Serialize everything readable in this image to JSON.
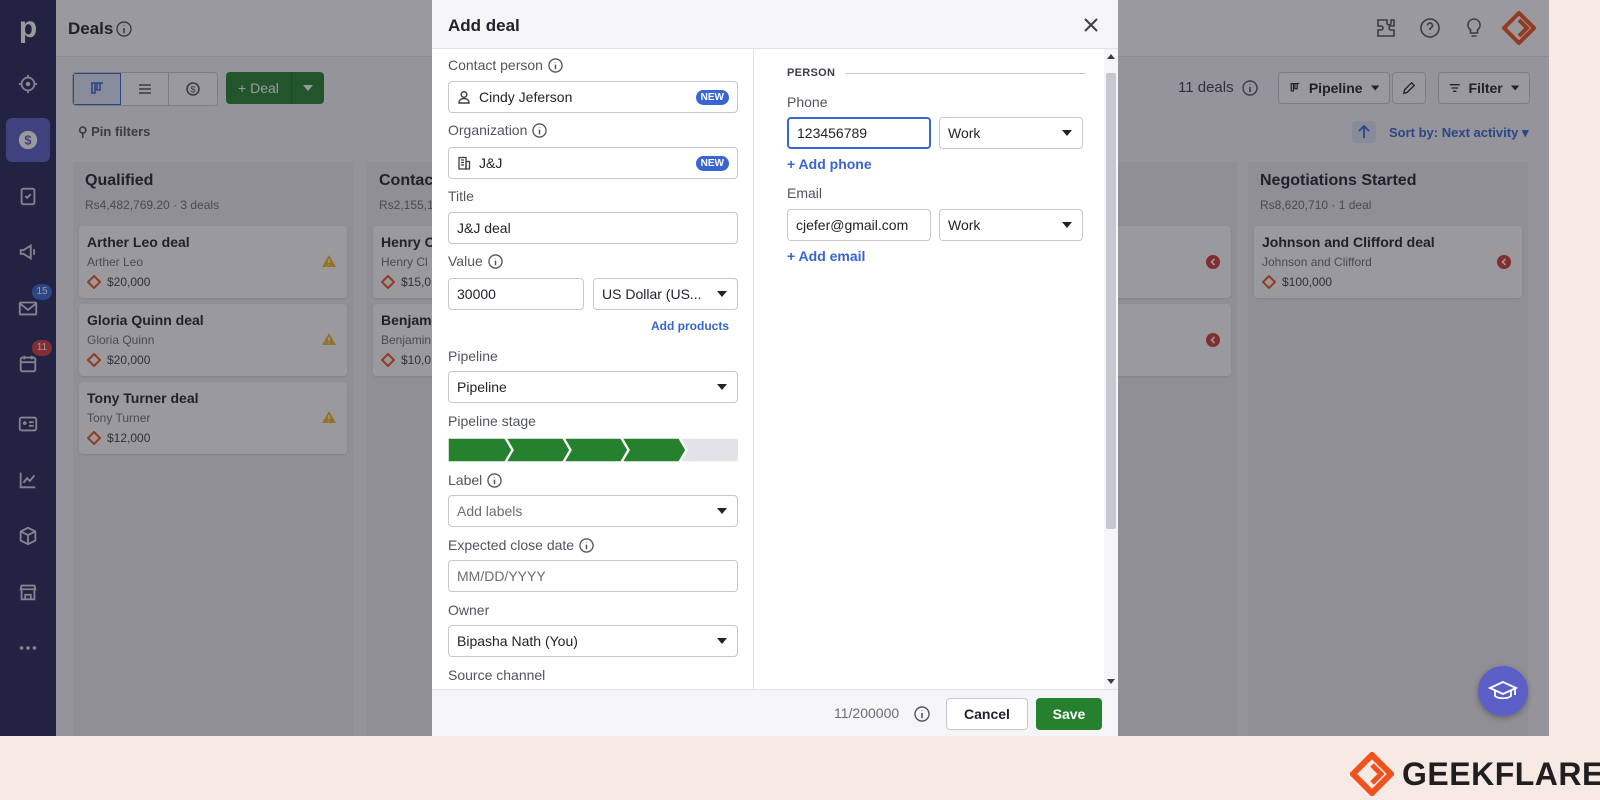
{
  "app": {
    "page_title": "Deals",
    "sidebar": {
      "mail_badge": "15",
      "calendar_badge": "11"
    },
    "toolbar": {
      "deal_button": "Deal",
      "pin_filters": "Pin filters",
      "deals_count": "11 deals",
      "pipeline_button": "Pipeline",
      "filter_button": "Filter",
      "sort_by": "Sort by: Next activity"
    },
    "columns": [
      {
        "title": "Qualified",
        "meta": "Rs4,482,769.20 · 3 deals",
        "cards": [
          {
            "title": "Arther Leo deal",
            "person": "Arther Leo",
            "value": "$20,000"
          },
          {
            "title": "Gloria Quinn deal",
            "person": "Gloria Quinn",
            "value": "$20,000"
          },
          {
            "title": "Tony Turner deal",
            "person": "Tony Turner",
            "value": "$12,000"
          }
        ]
      },
      {
        "title": "Contac",
        "meta": "Rs2,155,1",
        "cards": [
          {
            "title": "Henry C",
            "person": "Henry Cl",
            "value": "$15,0"
          },
          {
            "title": "Benjam",
            "person": "Benjamin",
            "value": "$10,0"
          }
        ]
      },
      {
        "title": "Negotiations Started",
        "meta": "Rs8,620,710 · 1 deal",
        "cards": [
          {
            "title": "Johnson and Clifford deal",
            "person": "Johnson and Clifford",
            "value": "$100,000"
          }
        ]
      }
    ]
  },
  "modal": {
    "title": "Add deal",
    "contact_person": {
      "label": "Contact person",
      "value": "Cindy Jeferson",
      "badge": "NEW"
    },
    "organization": {
      "label": "Organization",
      "value": "J&J",
      "badge": "NEW"
    },
    "title_field": {
      "label": "Title",
      "value": "J&J deal"
    },
    "value_field": {
      "label": "Value",
      "amount": "30000",
      "currency": "US Dollar (US..."
    },
    "add_products": "Add products",
    "pipeline": {
      "label": "Pipeline",
      "value": "Pipeline"
    },
    "pipeline_stage": {
      "label": "Pipeline stage",
      "active_stages": 4,
      "total_stages": 5
    },
    "label_field": {
      "label": "Label",
      "placeholder": "Add labels"
    },
    "expected_close": {
      "label": "Expected close date",
      "placeholder": "MM/DD/YYYY"
    },
    "owner": {
      "label": "Owner",
      "value": "Bipasha Nath (You)"
    },
    "source_channel": {
      "label": "Source channel"
    },
    "person_section": {
      "heading": "PERSON",
      "phone_label": "Phone",
      "phone_value": "123456789",
      "phone_type": "Work",
      "add_phone": "+ Add phone",
      "email_label": "Email",
      "email_value": "cjefer@gmail.com",
      "email_type": "Work",
      "add_email": "+ Add email"
    },
    "footer": {
      "char_count": "11/200000",
      "cancel": "Cancel",
      "save": "Save"
    }
  },
  "brand": {
    "name": "GEEKFLARE"
  },
  "colors": {
    "sidebar": "#26255a",
    "primary_green": "#26812f",
    "link_blue": "#3865d4",
    "brand_orange": "#f0521e"
  }
}
